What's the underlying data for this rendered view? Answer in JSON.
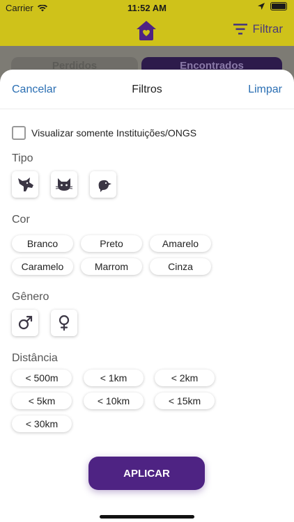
{
  "status_bar": {
    "carrier": "Carrier",
    "time": "11:52 AM"
  },
  "app_bar": {
    "filter_label": "Filtrar"
  },
  "segments": {
    "left": "Perdidos",
    "right": "Encontrados"
  },
  "sheet": {
    "cancel": "Cancelar",
    "title": "Filtros",
    "clear": "Limpar",
    "only_institutions": "Visualizar somente Instituições/ONGS",
    "tipo_label": "Tipo",
    "cor_label": "Cor",
    "genero_label": "Gênero",
    "distancia_label": "Distância",
    "apply": "APLICAR"
  },
  "types": [
    "dog-icon",
    "cat-icon",
    "bird-icon"
  ],
  "colors": [
    "Branco",
    "Preto",
    "Amarelo",
    "Caramelo",
    "Marrom",
    "Cinza"
  ],
  "genders": [
    "male-icon",
    "female-icon"
  ],
  "distances": [
    "< 500m",
    "< 1km",
    "< 2km",
    "< 5km",
    "< 10km",
    "< 15km",
    "< 30km"
  ],
  "theme": {
    "primary": "#4e2383",
    "accent_yellow": "#cfc21a",
    "link_blue": "#2b6fb3"
  }
}
